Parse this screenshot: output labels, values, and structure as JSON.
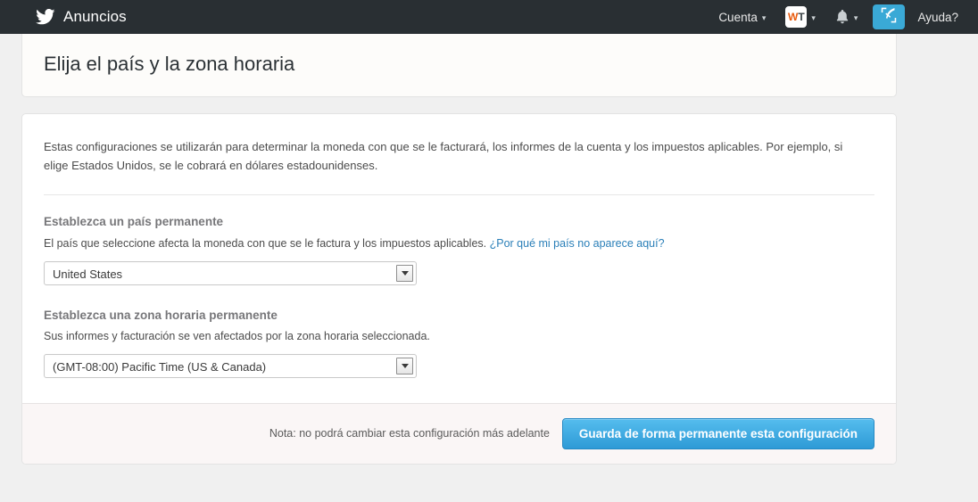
{
  "navbar": {
    "brand": "Anuncios",
    "brand_icon": "twitter-bird-icon",
    "account_label": "Cuenta",
    "account_caret": "▾",
    "wt_badge": {
      "w": "W",
      "t": "T",
      "caret": "▾"
    },
    "notifications_icon": "bell-icon",
    "notifications_caret": "▾",
    "compose_icon": "compose-quill-icon",
    "help_label": "Ayuda?",
    "background_color": "#292f33"
  },
  "title_card": {
    "title": "Elija el país y la zona horaria"
  },
  "main": {
    "intro": "Estas configuraciones se utilizarán para determinar la moneda con que se le facturará, los informes de la cuenta y los impuestos aplicables. Por ejemplo, si elige Estados Unidos, se le cobrará en dólares estadounidenses.",
    "country": {
      "label": "Establezca un país permanente",
      "help_text": "El país que seleccione afecta la moneda con que se le factura y los impuestos aplicables.",
      "help_link": "¿Por qué mi país no aparece aquí?",
      "selected": "United States"
    },
    "timezone": {
      "label": "Establezca una zona horaria permanente",
      "help_text": "Sus informes y facturación se ven afectados por la zona horaria seleccionada.",
      "selected": "(GMT-08:00) Pacific Time (US & Canada)"
    }
  },
  "footer": {
    "note": "Nota: no podrá cambiar esta configuración más adelante",
    "save_label": "Guarda de forma permanente esta configuración",
    "save_color": "#2e9ad6"
  },
  "colors": {
    "link": "#2a7fb8",
    "accent": "#3aa9d6",
    "page_bg": "#f0f0f0",
    "label_gray": "#77777a"
  }
}
